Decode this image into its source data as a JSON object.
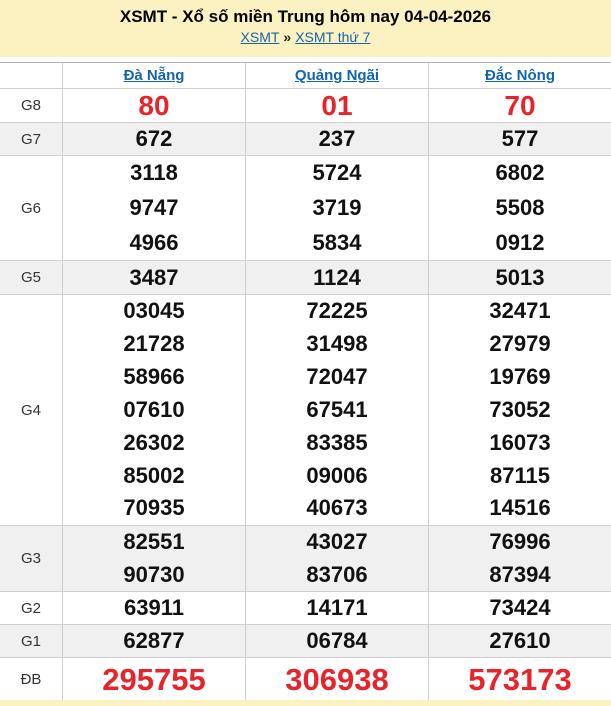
{
  "header": {
    "title": "XSMT - Xổ số miền Trung hôm nay 04-04-2026",
    "breadcrumb": {
      "link1": "XSMT",
      "separator": "»",
      "link2": "XSMT thứ 7"
    }
  },
  "table": {
    "columns": [
      "Đà Nẵng",
      "Quảng Ngãi",
      "Đắc Nông"
    ],
    "rows": [
      {
        "key": "g8",
        "label": "G8",
        "values": [
          [
            "80"
          ],
          [
            "01"
          ],
          [
            "70"
          ]
        ]
      },
      {
        "key": "g7",
        "label": "G7",
        "values": [
          [
            "672"
          ],
          [
            "237"
          ],
          [
            "577"
          ]
        ]
      },
      {
        "key": "g6",
        "label": "G6",
        "values": [
          [
            "3118",
            "9747",
            "4966"
          ],
          [
            "5724",
            "3719",
            "5834"
          ],
          [
            "6802",
            "5508",
            "0912"
          ]
        ]
      },
      {
        "key": "g5",
        "label": "G5",
        "values": [
          [
            "3487"
          ],
          [
            "1124"
          ],
          [
            "5013"
          ]
        ]
      },
      {
        "key": "g4",
        "label": "G4",
        "values": [
          [
            "03045",
            "21728",
            "58966",
            "07610",
            "26302",
            "85002",
            "70935"
          ],
          [
            "72225",
            "31498",
            "72047",
            "67541",
            "83385",
            "09006",
            "40673"
          ],
          [
            "32471",
            "27979",
            "19769",
            "73052",
            "16073",
            "87115",
            "14516"
          ]
        ]
      },
      {
        "key": "g3",
        "label": "G3",
        "values": [
          [
            "82551",
            "90730"
          ],
          [
            "43027",
            "83706"
          ],
          [
            "76996",
            "87394"
          ]
        ]
      },
      {
        "key": "g2",
        "label": "G2",
        "values": [
          [
            "63911"
          ],
          [
            "14171"
          ],
          [
            "73424"
          ]
        ]
      },
      {
        "key": "g1",
        "label": "G1",
        "values": [
          [
            "62877"
          ],
          [
            "06784"
          ],
          [
            "27610"
          ]
        ]
      },
      {
        "key": "db",
        "label": "ĐB",
        "values": [
          [
            "295755"
          ],
          [
            "306938"
          ],
          [
            "573173"
          ]
        ]
      }
    ]
  },
  "colors": {
    "banner_bg": "#fcf2c1",
    "link_blue": "#1464ac",
    "accent_red": "#e8242b",
    "row_shade": "#f0f0f0",
    "border": "#cfcfcf"
  }
}
